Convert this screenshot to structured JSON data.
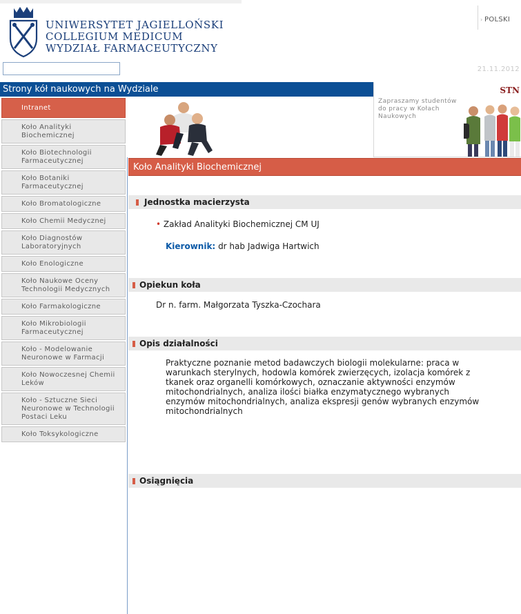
{
  "header": {
    "university": [
      "UNIWERSYTET JAGIELLOŃSKI",
      "COLLEGIUM MEDICUM",
      "WYDZIAŁ FARMACEUTYCZNY"
    ],
    "language_link": "POLSKI",
    "search": {
      "value": "",
      "placeholder": ""
    },
    "date": "21.11.2012"
  },
  "site_title": "Strony kół naukowych na Wydziale",
  "promo": {
    "title": "STN",
    "text": "Zapraszamy studentów do pracy w Kołach Naukowych"
  },
  "sidebar": {
    "items": [
      {
        "label": "Intranet",
        "active": true
      },
      {
        "label": "Koło Analityki Biochemicznej"
      },
      {
        "label": "Koło Biotechnologii Farmaceutycznej"
      },
      {
        "label": "Koło Botaniki Farmaceutycznej"
      },
      {
        "label": "Koło Bromatologiczne"
      },
      {
        "label": "Koło Chemii Medycznej"
      },
      {
        "label": "Koło Diagnostów Laboratoryjnych"
      },
      {
        "label": "Koło Enologiczne"
      },
      {
        "label": "Koło Naukowe Oceny Technologii Medycznych"
      },
      {
        "label": "Koło Farmakologiczne"
      },
      {
        "label": "Koło Mikrobiologii Farmaceutycznej"
      },
      {
        "label": "Koło - Modelowanie Neuronowe w Farmacji"
      },
      {
        "label": "Koło Nowoczesnej Chemii Leków"
      },
      {
        "label": "Koło - Sztuczne Sieci Neuronowe w Technologii Postaci Leku"
      },
      {
        "label": "Koło Toksykologiczne"
      }
    ]
  },
  "content": {
    "heading": "Koło Analityki Biochemicznej",
    "sections": [
      {
        "title": "Jednostka macierzysta",
        "unit": "Zakład Analityki Biochemicznej CM UJ",
        "head_label": "Kierownik:",
        "head_name": "dr hab Jadwiga Hartwich"
      },
      {
        "title": "Opiekun koła",
        "text": "Dr n. farm. Małgorzata Tyszka-Czochara"
      },
      {
        "title": "Opis działalności",
        "lines": [
          "Praktyczne poznanie metod badawczych biologii molekularne: praca w",
          "warunkach sterylnych, hodowla komórek zwierzęcych, izolacja komórek z",
          "tkanek oraz organelli komórkowych, oznaczanie aktywności enzymów",
          "mitochondrialnych, analiza ilości białka enzymatycznego wybranych",
          "enzymów mitochondrialnych, analiza ekspresji genów wybranych enzymów",
          "mitochondrialnych"
        ]
      },
      {
        "title": "Osiągnięcia"
      }
    ]
  },
  "colors": {
    "brand_blue": "#0c4f95",
    "accent_red": "#d65d47",
    "label_blue": "#0d5aa7",
    "crest_blue": "#1b3f7a"
  }
}
